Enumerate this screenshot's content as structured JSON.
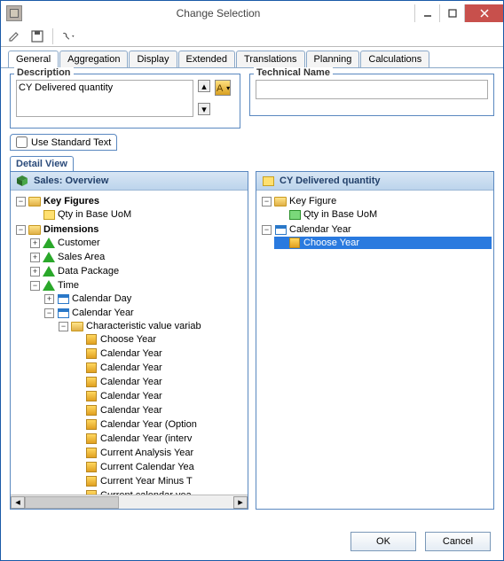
{
  "window": {
    "title": "Change Selection",
    "minimize": "Minimize",
    "maximize": "Maximize",
    "close": "Close"
  },
  "tabs": {
    "general": "General",
    "aggregation": "Aggregation",
    "display": "Display",
    "extended": "Extended",
    "translations": "Translations",
    "planning": "Planning",
    "calculations": "Calculations"
  },
  "section": {
    "description_label": "Description",
    "technical_label": "Technical Name",
    "description_value": "CY Delivered quantity",
    "technical_value": "",
    "use_standard_text": "Use Standard Text",
    "detail_view": "Detail View"
  },
  "leftpane": {
    "title": "Sales: Overview",
    "key_figures": "Key Figures",
    "qty_base_uom": "Qty in Base UoM",
    "dimensions": "Dimensions",
    "customer": "Customer",
    "sales_area": "Sales Area",
    "data_package": "Data Package",
    "time": "Time",
    "calendar_day": "Calendar Day",
    "calendar_year": "Calendar Year",
    "char_val_var": "Characteristic value variab",
    "vars": [
      "Choose Year",
      "Calendar Year",
      "Calendar Year",
      "Calendar Year",
      "Calendar Year",
      "Calendar Year",
      "Calendar Year (Option",
      "Calendar Year (interv",
      "Current Analysis Year",
      "Current Calendar Yea",
      "Current Year Minus T",
      "Current calendar yea"
    ]
  },
  "rightpane": {
    "title": "CY Delivered quantity",
    "key_figure": "Key Figure",
    "qty_base_uom": "Qty in Base UoM",
    "calendar_year": "Calendar Year",
    "choose_year": "Choose Year"
  },
  "buttons": {
    "ok": "OK",
    "cancel": "Cancel"
  }
}
